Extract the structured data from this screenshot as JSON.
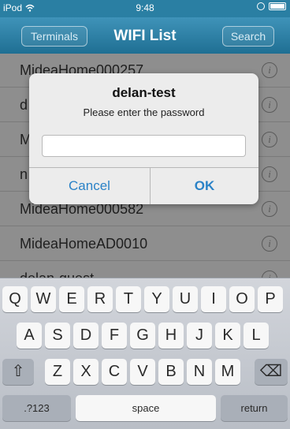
{
  "status_bar": {
    "device": "iPod",
    "time": "9:48"
  },
  "nav": {
    "title": "WIFI List",
    "left_button": "Terminals",
    "right_button": "Search"
  },
  "list": {
    "items": [
      {
        "ssid": "MideaHome000257"
      },
      {
        "ssid": "d"
      },
      {
        "ssid": "M"
      },
      {
        "ssid": "n"
      },
      {
        "ssid": "MideaHome000582"
      },
      {
        "ssid": "MideaHomeAD0010"
      },
      {
        "ssid": "delan-guest"
      }
    ]
  },
  "alert": {
    "title": "delan-test",
    "message": "Please enter the password",
    "input_value": "",
    "cancel_label": "Cancel",
    "ok_label": "OK"
  },
  "keyboard": {
    "row1": [
      "Q",
      "W",
      "E",
      "R",
      "T",
      "Y",
      "U",
      "I",
      "O",
      "P"
    ],
    "row2": [
      "A",
      "S",
      "D",
      "F",
      "G",
      "H",
      "J",
      "K",
      "L"
    ],
    "row3": [
      "Z",
      "X",
      "C",
      "V",
      "B",
      "N",
      "M"
    ],
    "shift_glyph": "⇧",
    "delete_glyph": "⌫",
    "numbers_label": ".?123",
    "space_label": "space",
    "return_label": "return"
  },
  "colors": {
    "accent": "#2a82c7",
    "nav": "#2a7fa3",
    "dim_list": "#8e8e8e"
  }
}
